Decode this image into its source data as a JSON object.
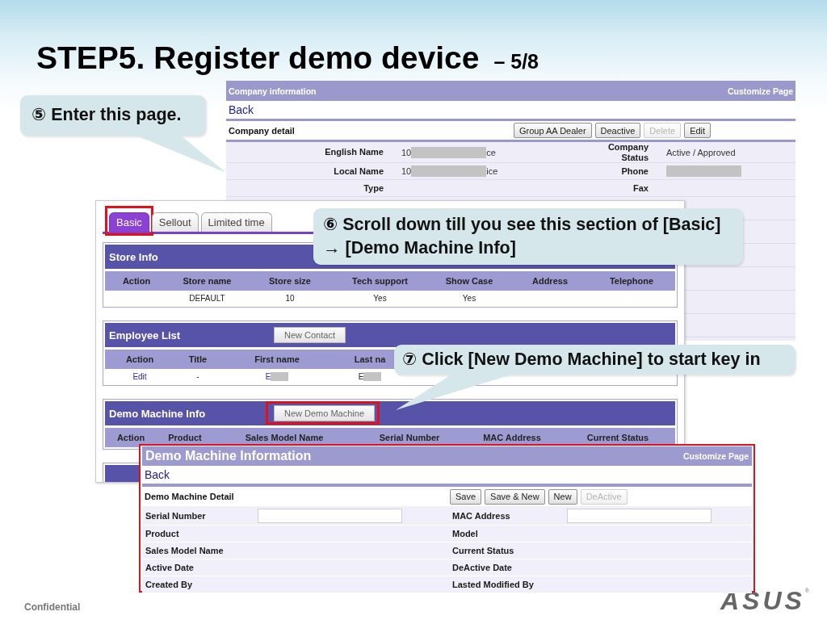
{
  "slide": {
    "title": "STEP5. Register demo device",
    "page": "– 5/8",
    "footer": "Confidential",
    "logo": "ASUS",
    "logo_mark": "®"
  },
  "callouts": [
    {
      "lines": [
        "⑤ Enter this page."
      ]
    },
    {
      "lines": [
        "⑥ Scroll down till you see this section of [Basic]",
        "→ [Demo Machine Info]"
      ]
    },
    {
      "lines": [
        "⑦ Click [New Demo Machine] to start key in"
      ]
    }
  ],
  "company_page": {
    "header": "Company information",
    "customize_link": "Customize Page",
    "back_link": "Back",
    "detail_title": "Company detail",
    "buttons": [
      {
        "label": "Group AA Dealer",
        "disabled": false
      },
      {
        "label": "Deactive",
        "disabled": false
      },
      {
        "label": "Delete",
        "disabled": true
      },
      {
        "label": "Edit",
        "disabled": false
      }
    ],
    "rows": [
      [
        {
          "label": "English Name",
          "value": "10",
          "redacted": true,
          "value_end": "ce"
        },
        {
          "label": "Company Status",
          "value": "Active / Approved"
        }
      ],
      [
        {
          "label": "Local Name",
          "value": "10",
          "redacted": true,
          "value_end": "ice"
        },
        {
          "label": "Phone",
          "redacted": true
        }
      ],
      [
        {
          "label": "Type"
        },
        {
          "label": "Fax"
        }
      ]
    ]
  },
  "basic_page": {
    "tabs": [
      {
        "label": "Basic",
        "selected": true,
        "highlighted": true
      },
      {
        "label": "Sellout",
        "selected": false
      },
      {
        "label": "Limited time",
        "selected": false
      }
    ],
    "sections": [
      {
        "kind": "store",
        "title": "Store Info",
        "columns": [
          "Action",
          "Store name",
          "Store size",
          "Tech support",
          "Show Case",
          "Address",
          "Telephone"
        ],
        "rows": [
          [
            {},
            {
              "text": "DEFAULT",
              "link": false
            },
            {
              "text": "10",
              "link": false
            },
            {
              "text": "Yes",
              "link": false
            },
            {
              "text": "Yes",
              "link": false
            }
          ]
        ]
      },
      {
        "kind": "employee",
        "title": "Employee List",
        "button": {
          "label": "New Contact"
        },
        "columns": [
          "Action",
          "Title",
          "First name",
          "Last na"
        ],
        "rows": [
          [
            {
              "text": "Edit",
              "link": true
            },
            {
              "text": "-",
              "link": false
            },
            {
              "text": "E",
              "link": true,
              "redacted": true
            },
            {
              "text": "E",
              "link": false,
              "redacted": true
            }
          ]
        ]
      },
      {
        "kind": "demo",
        "title": "Demo Machine Info",
        "button": {
          "label": "New Demo Machine",
          "highlighted": true
        },
        "columns": [
          "Action",
          "Product",
          "Sales Model Name",
          "Serial Number",
          "MAC Address",
          "Current Status"
        ]
      }
    ]
  },
  "demo_popup": {
    "title": "Demo Machine Information",
    "customize_link": "Customize Page",
    "back_link": "Back",
    "detail_title": "Demo Machine Detail",
    "highlighted": true,
    "buttons": [
      {
        "label": "Save",
        "disabled": false
      },
      {
        "label": "Save & New",
        "disabled": false
      },
      {
        "label": "New",
        "disabled": false
      },
      {
        "label": "DeActive",
        "disabled": true
      }
    ],
    "rows": [
      [
        {
          "label": "Serial Number",
          "kind": "input"
        },
        {
          "label": "MAC Address",
          "kind": "input"
        }
      ],
      [
        {
          "label": "Product",
          "kind": "text"
        },
        {
          "label": "Model",
          "kind": "text"
        }
      ],
      [
        {
          "label": "Sales Model Name",
          "kind": "text"
        },
        {
          "label": "Current Status",
          "kind": "text"
        }
      ],
      [
        {
          "label": "Active Date",
          "kind": "text"
        },
        {
          "label": "DeActive Date",
          "kind": "text"
        }
      ],
      [
        {
          "label": "Created By",
          "kind": "text"
        },
        {
          "label": "Lasted Modified By",
          "kind": "text"
        }
      ]
    ]
  }
}
